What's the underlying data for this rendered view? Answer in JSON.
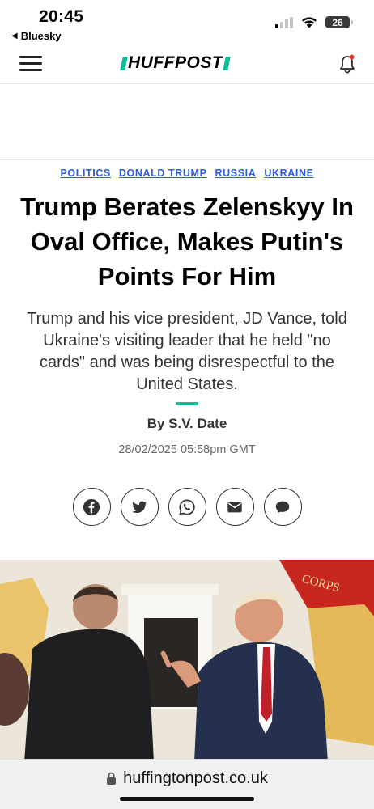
{
  "status_bar": {
    "time": "20:45",
    "back_app": "Bluesky",
    "battery": "26"
  },
  "header": {
    "logo": "HUFFPOST",
    "brand_color": "#0dbe98"
  },
  "tags": [
    "POLITICS",
    "DONALD TRUMP",
    "RUSSIA",
    "UKRAINE"
  ],
  "article": {
    "headline": "Trump Berates Zelenskyy In Oval Office, Makes Putin's Points For Him",
    "summary": "Trump and his vice president, JD Vance, told Ukraine's visiting leader that he held \"no cards\" and was being disrespectful to the United States.",
    "byline_prefix": "By",
    "author": "S.V. Date",
    "timestamp": "28/02/2025 05:58pm GMT",
    "photo_flag_text": "CORPS"
  },
  "share_buttons": [
    "facebook-icon",
    "twitter-icon",
    "whatsapp-icon",
    "email-icon",
    "comment-icon"
  ],
  "browser": {
    "url": "huffingtonpost.co.uk"
  },
  "colors": {
    "tag_link": "#2e5be0",
    "accent": "#0dbe98"
  }
}
